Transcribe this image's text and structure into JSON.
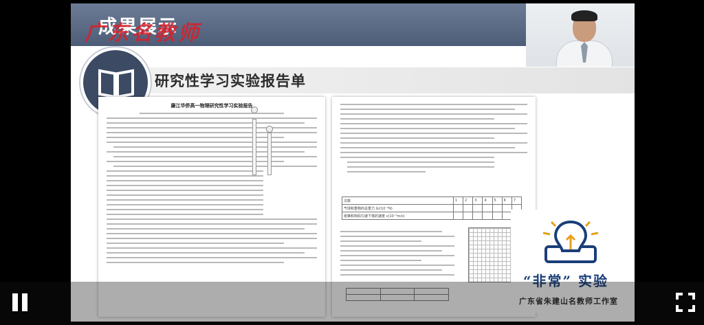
{
  "header": {
    "title": "成果展示",
    "watermark": "广东名教师"
  },
  "subtitle": "研究性学习实验报告单",
  "document": {
    "left_title": "廉江华侨高一物理研究性学习实验报告",
    "table_first_col": "次数",
    "table_cols": [
      "1",
      "2",
      "3",
      "4",
      "5",
      "6",
      "7"
    ],
    "table_rows": [
      "气球和重物的总重力 G/(10⁻²N)",
      "纸锥和钩码匀速下落的速度 v(10⁻²m/s)"
    ]
  },
  "logo": {
    "text": "“非常” 实验",
    "subtitle": "广东省朱建山名教师工作室"
  },
  "icons": {
    "book": "book-icon",
    "bulb": "lightbulb-icon",
    "pause": "pause-icon",
    "fullscreen": "fullscreen-icon"
  },
  "colors": {
    "header_band": "#5a6a86",
    "logo_blue": "#1a3e78",
    "watermark_red": "#d8202a"
  }
}
